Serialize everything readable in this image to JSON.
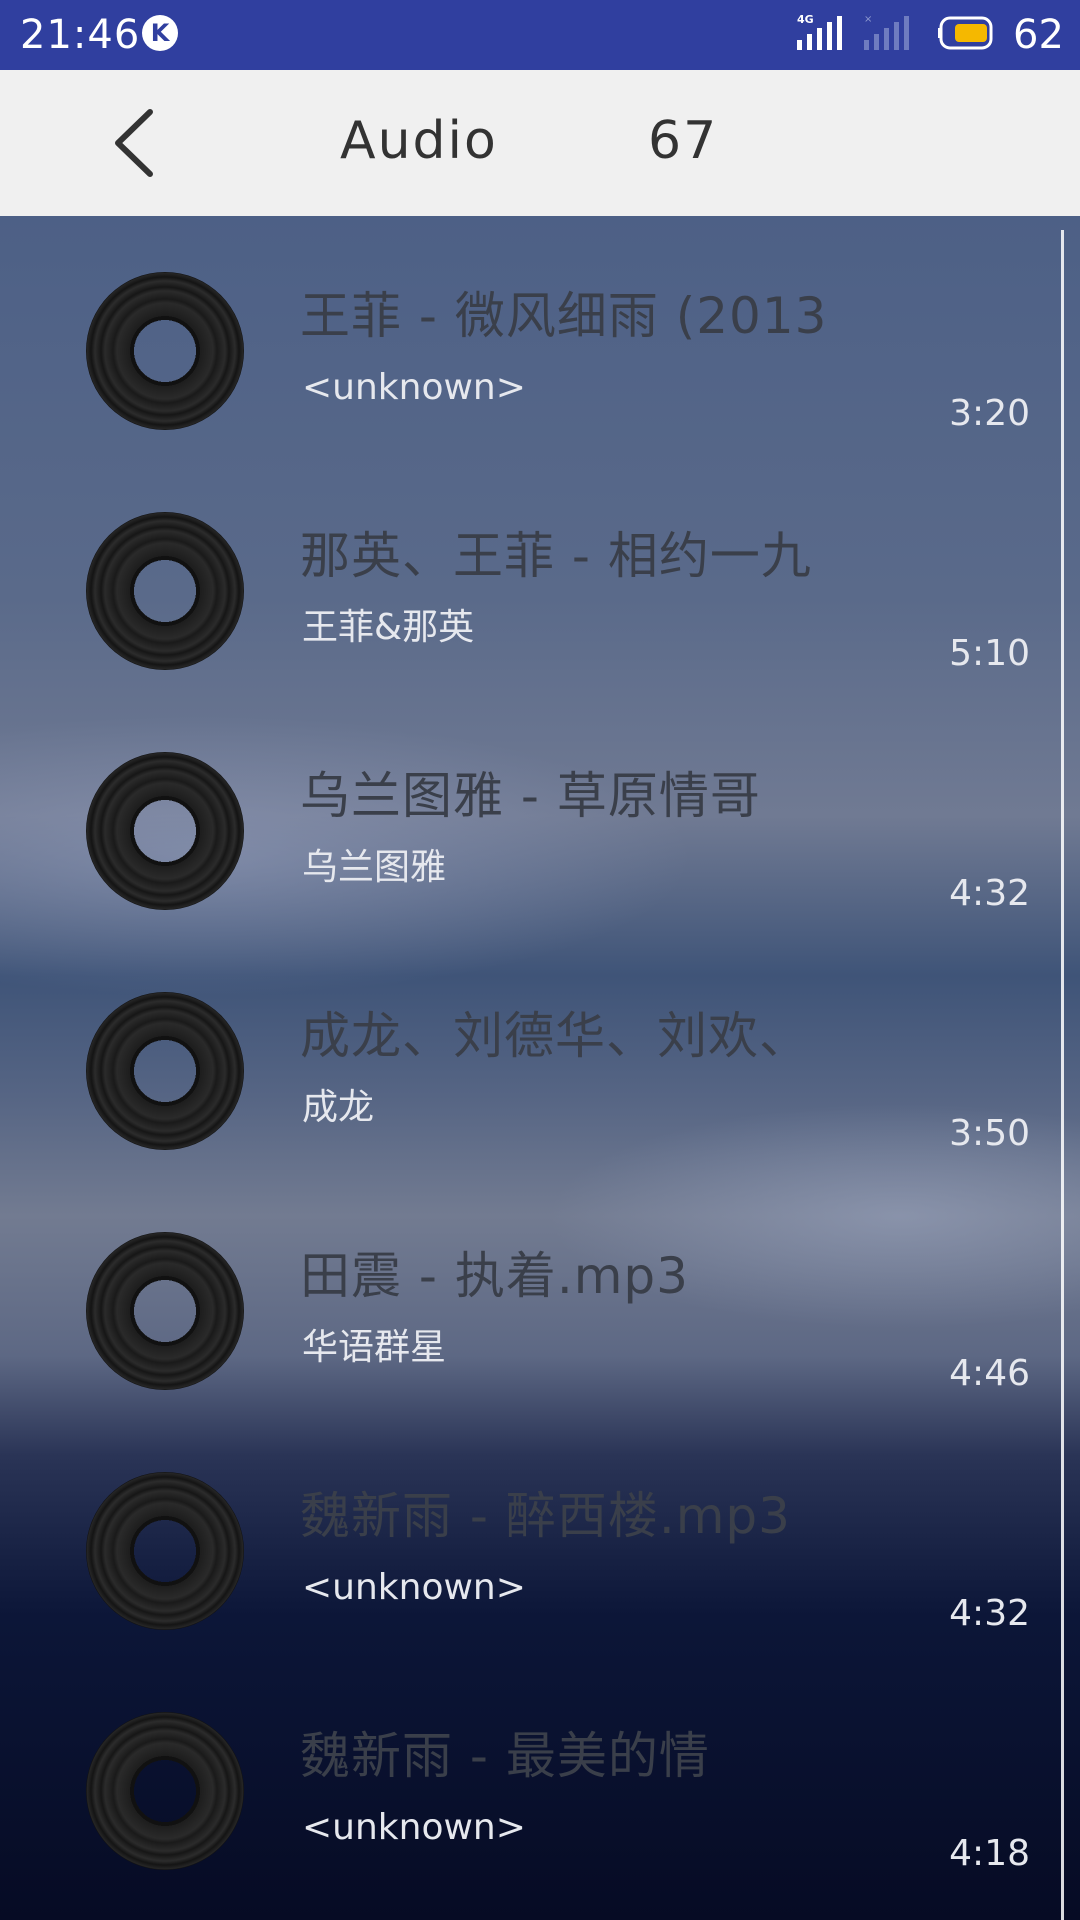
{
  "status_bar": {
    "time": "21:46",
    "app_badge": "K",
    "network_label": "4G",
    "battery_level": "62",
    "battery_color": "#f5b800"
  },
  "header": {
    "title": "Audio",
    "count": "67",
    "back_icon": "chevron-left-icon"
  },
  "songs": [
    {
      "title": "王菲 - 微风细雨 (2013",
      "artist": "<unknown>",
      "duration": "3:20"
    },
    {
      "title": "那英、王菲 - 相约一九",
      "artist": "王菲&那英",
      "duration": "5:10"
    },
    {
      "title": "乌兰图雅 - 草原情哥",
      "artist": "乌兰图雅",
      "duration": "4:32"
    },
    {
      "title": "成龙、刘德华、刘欢、",
      "artist": "成龙",
      "duration": "3:50"
    },
    {
      "title": "田震 - 执着.mp3",
      "artist": "华语群星",
      "duration": "4:46"
    },
    {
      "title": "魏新雨 - 醉西楼.mp3",
      "artist": "<unknown>",
      "duration": "4:32"
    },
    {
      "title": "魏新雨 - 最美的情",
      "artist": "<unknown>",
      "duration": "4:18"
    }
  ],
  "colors": {
    "status_bar": "#303f9f",
    "header_bg": "#f0f0f0",
    "title_text": "#3a3f4a",
    "secondary_text": "#e6e8ee"
  }
}
